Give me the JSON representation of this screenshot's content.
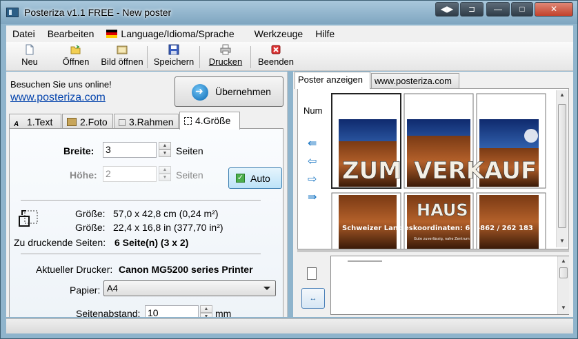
{
  "window": {
    "title": "Posteriza v1.1 FREE - New poster",
    "controls": {
      "restore_tabs": "◀▶",
      "minimize": "—",
      "maximize": "□",
      "close": "✕"
    }
  },
  "menu": {
    "items": [
      "Datei",
      "Bearbeiten",
      "Language/Idioma/Sprache",
      "Werkzeuge",
      "Hilfe"
    ]
  },
  "toolbar": {
    "buttons": [
      {
        "label": "Neu",
        "icon": "new-document-icon"
      },
      {
        "label": "Öffnen",
        "icon": "open-folder-icon"
      },
      {
        "label": "Bild öffnen",
        "icon": "open-image-icon"
      },
      {
        "label": "Speichern",
        "icon": "save-disk-icon"
      },
      {
        "label": "Drucken",
        "icon": "printer-icon"
      },
      {
        "label": "Beenden",
        "icon": "exit-icon"
      }
    ]
  },
  "promo": {
    "text": "Besuchen Sie uns online!",
    "link": "www.posteriza.com"
  },
  "apply_button": "Übernehmen",
  "tabs": [
    {
      "label": "1.Text",
      "icon": "text-icon"
    },
    {
      "label": "2.Foto",
      "icon": "photo-icon"
    },
    {
      "label": "3.Rahmen",
      "icon": "frame-icon"
    },
    {
      "label": "4.Größe",
      "icon": "resize-icon",
      "active": true
    }
  ],
  "size_tab": {
    "width_label": "Breite:",
    "width_value": "3",
    "width_unit": "Seiten",
    "height_label": "Höhe:",
    "height_value": "2",
    "height_unit": "Seiten",
    "auto_label": "Auto",
    "auto_checked": true,
    "size_label_1": "Größe:",
    "size_value_1": "57,0 x 42,8 cm (0,24 m²)",
    "size_label_2": "Größe:",
    "size_value_2": "22,4 x 16,8 in (377,70 in²)",
    "pages_label": "Zu druckende Seiten:",
    "pages_value": "6 Seite(n) (3 x 2)",
    "printer_label": "Aktueller Drucker:",
    "printer_value": "Canon MG5200 series Printer",
    "paper_label": "Papier:",
    "paper_value": "A4",
    "margin_label": "Seitenabstand:",
    "margin_value": "10",
    "margin_unit": "mm"
  },
  "right_tabs": [
    {
      "label": "Poster anzeigen",
      "active": true
    },
    {
      "label": "www.posteriza.com",
      "active": false
    }
  ],
  "preview": {
    "num_label": "Num",
    "poster_text_top_left": "ZUM",
    "poster_text_top_right": "VERKAUF",
    "poster_text_haus": "HAUS",
    "poster_text_bottom": "Schweizer Land",
    "poster_text_coords": "eskoordinaten: 6",
    "poster_text_coords2": "-862 / 262 183",
    "poster_text_small": "Gute zuverlässig, nahe Zentrum",
    "colors": {
      "sky": "#1c3f86",
      "horizon": "#e08a3c",
      "wall": "#8b4a22"
    }
  },
  "nav_arrows": [
    "left-double-arrow-icon",
    "left-arrow-icon",
    "right-arrow-icon",
    "right-double-arrow-icon"
  ]
}
